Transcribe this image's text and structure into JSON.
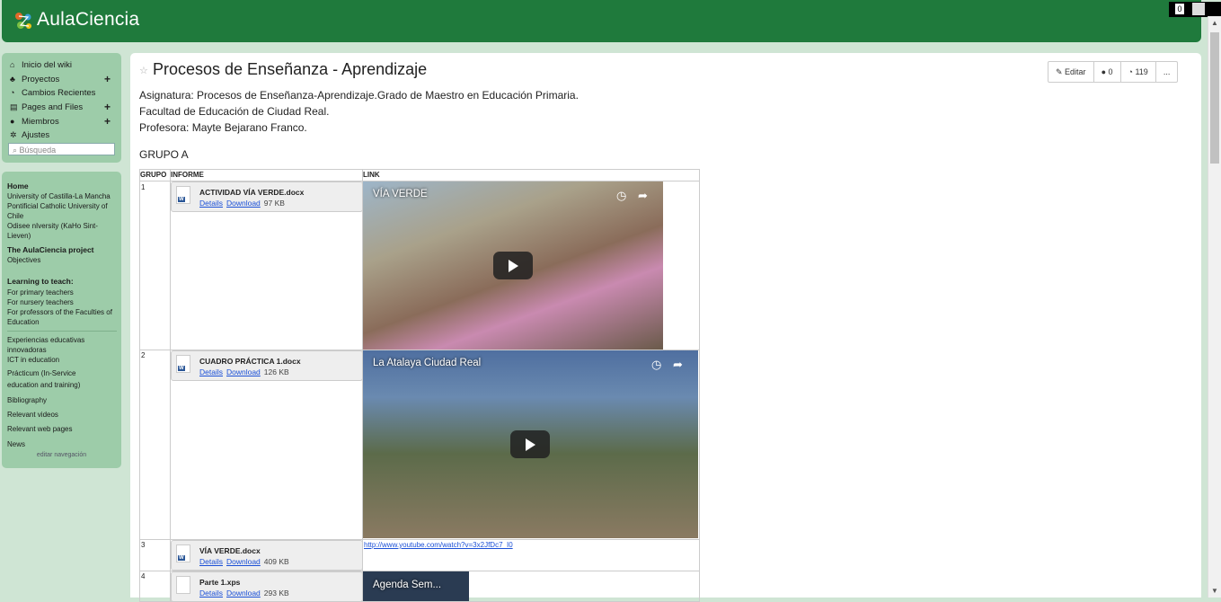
{
  "header": {
    "brand": "AulaCiencia",
    "notif_count": "0"
  },
  "sidebar": {
    "top_items": [
      {
        "label": "Inicio del wiki",
        "icon": "home-icon"
      },
      {
        "label": "Proyectos",
        "icon": "sitemap-icon"
      },
      {
        "label": "Cambios Recientes",
        "icon": "clock-icon"
      },
      {
        "label": "Pages and Files",
        "icon": "files-icon"
      },
      {
        "label": "Miembros",
        "icon": "user-icon"
      },
      {
        "label": "Ajustes",
        "icon": "gear-icon"
      }
    ],
    "search_placeholder": "Búsqueda",
    "nav": {
      "home": "Home",
      "uclm": "University of Castilla-La Mancha",
      "puc": "Pontificial Catholic University of",
      "chile": "Chile",
      "odisee1": "Odisee nIversity (KaHo Sint-",
      "odisee2": "Lieven)",
      "project": "The AulaCiencia project",
      "objectives": "Objectives",
      "learning": "Learning to teach:",
      "primary": "For primary teachers",
      "nursery": "For nursery teachers",
      "profs1": "For professors of the Faculties of",
      "profs2": "Education",
      "exp1": "Experiencias educativas",
      "exp2": "innovadoras",
      "ict": "ICT in education",
      "practicum1": "Prácticum (In-Service",
      "practicum2": "education and training)",
      "biblio": "Bibliography",
      "videos": "Relevant videos",
      "webpages": "Relevant web pages",
      "news": "News",
      "edit_nav": "editar navegación"
    }
  },
  "page": {
    "title": "Procesos de Enseñanza - Aprendizaje",
    "actions": {
      "edit": "Editar",
      "comments": "0",
      "history": "119",
      "more": "..."
    },
    "intro": [
      "Asignatura: Procesos de Enseñanza-Aprendizaje.Grado de Maestro en Educación Primaria.",
      "Facultad de Educación de Ciudad Real.",
      "Profesora: Mayte Bejarano Franco."
    ],
    "group_title": "GRUPO A",
    "table": {
      "headers": [
        "GRUPO",
        "INFORME",
        "LINK"
      ],
      "rows": [
        {
          "num": "1",
          "file": "ACTIVIDAD VÍA VERDE.docx",
          "details": "Details",
          "download": "Download",
          "size": "97 KB",
          "video_title": "VÍA VERDE"
        },
        {
          "num": "2",
          "file": "CUADRO PRÁCTICA 1.docx",
          "details": "Details",
          "download": "Download",
          "size": "126 KB",
          "video_title": "La Atalaya Ciudad Real"
        },
        {
          "num": "3",
          "file": "VÍA VERDE.docx",
          "details": "Details",
          "download": "Download",
          "size": "409 KB",
          "link": "http://www.youtube.com/watch?v=3x2JfDc7_I0"
        },
        {
          "num": "4",
          "file": "Parte 1.xps",
          "details": "Details",
          "download": "Download",
          "size": "293 KB",
          "video_title": "Agenda Sem..."
        }
      ]
    }
  }
}
